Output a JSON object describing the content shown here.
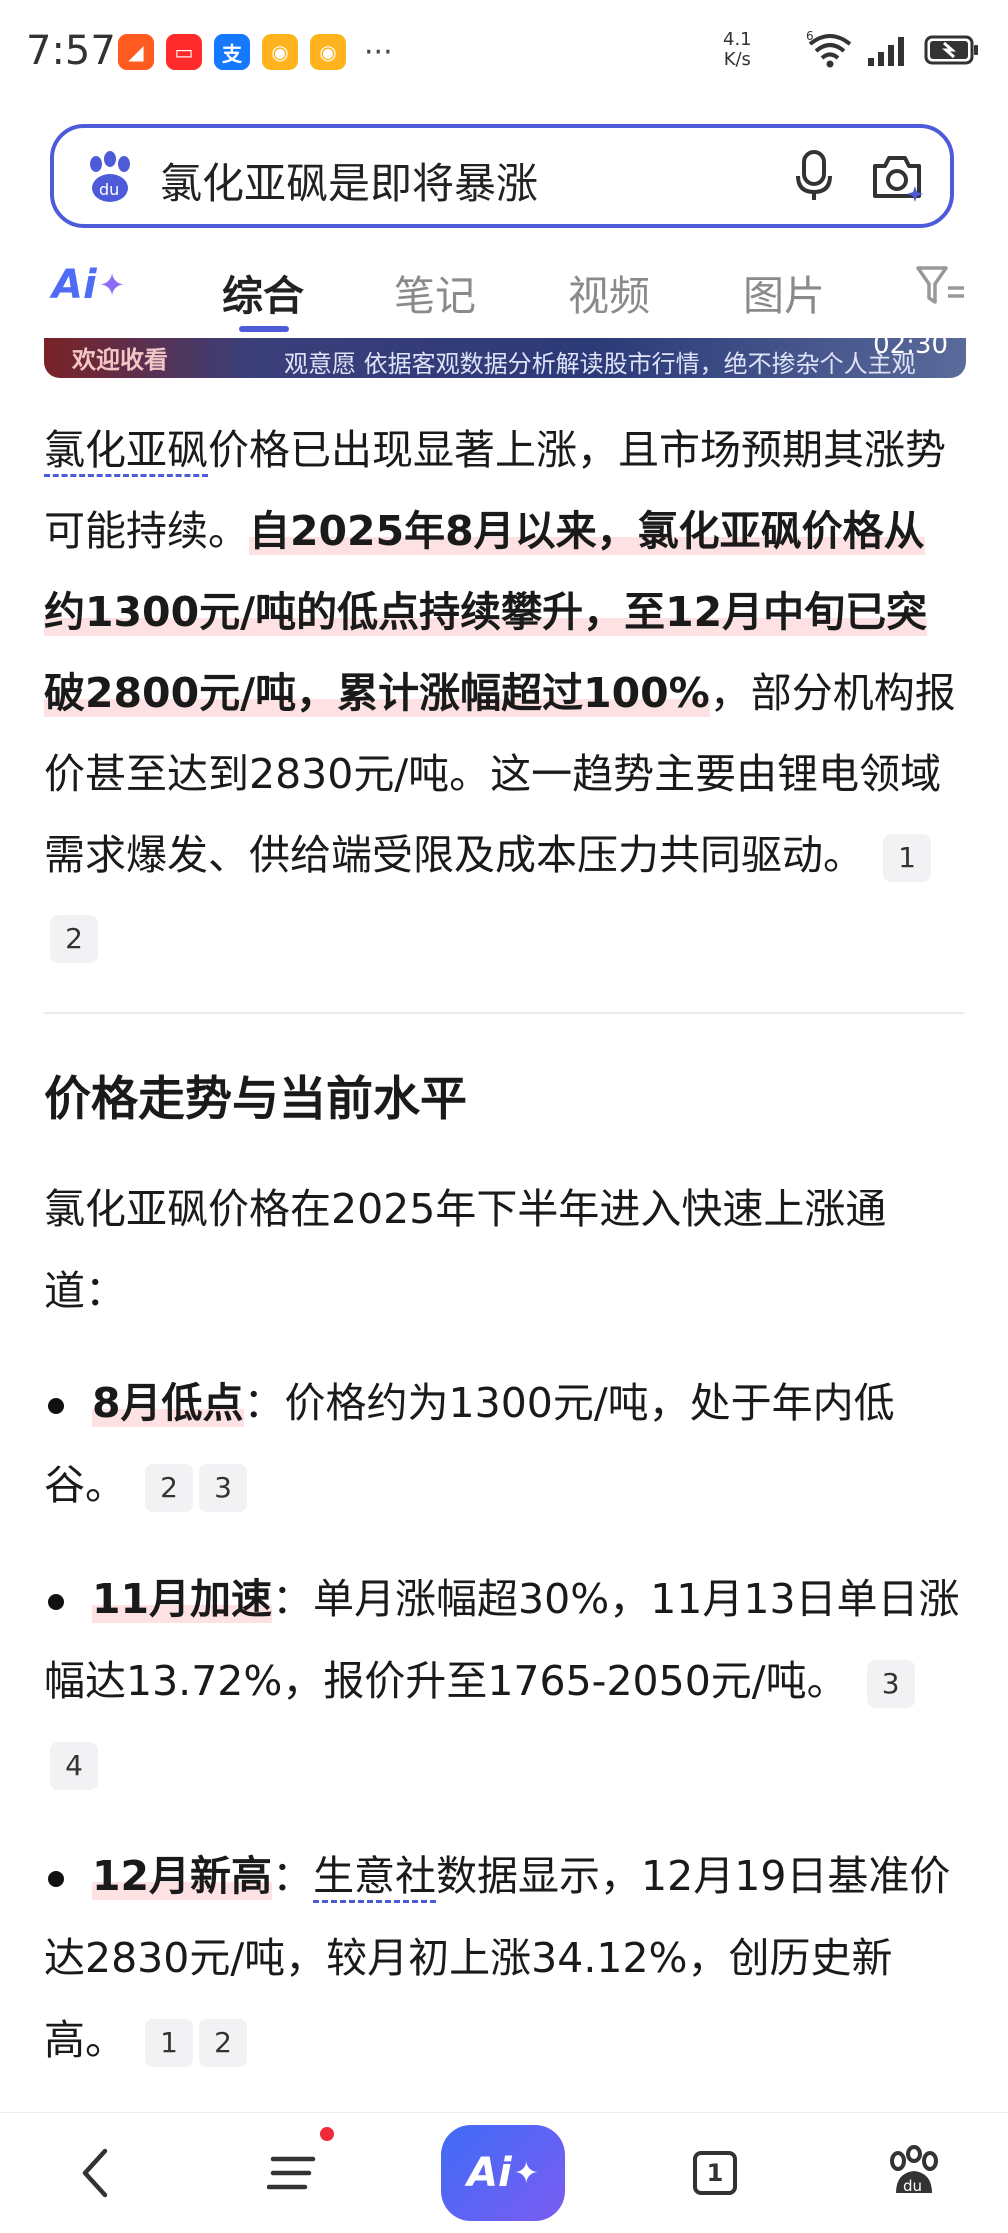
{
  "status_bar": {
    "time": "7:57",
    "overflow": "···",
    "net_speed_value": "4.1",
    "net_speed_unit": "K/s",
    "wifi_label": "6",
    "battery": "full"
  },
  "search": {
    "query": "氯化亚砜是即将暴涨"
  },
  "tabs": {
    "ai_label": "Ai",
    "items": [
      "综合",
      "笔记",
      "视频",
      "图片"
    ],
    "active": "综合"
  },
  "video_strip": {
    "left_text": "欢迎收看",
    "center_text": "观意愿  依据客观数据分析解读股市行情，绝不掺杂个人主观",
    "time": "02:30"
  },
  "intro": {
    "link_term": "氯化亚砜",
    "part1_rest": "价格已出现显著上涨，且市场预期其涨势可能持续。",
    "highlight": "自2025年8月以来，氯化亚砜价格从约1300元/吨的低点持续攀升，至12月中旬已突破2800元/吨，累计涨幅超过100%",
    "part2": "，部分机构报价甚至达到2830元/吨。这一趋势主要由锂电领域需求爆发、供给端受限及成本压力共同驱动。",
    "citations": [
      "1",
      "2"
    ]
  },
  "section": {
    "heading": "价格走势与当前水平",
    "intro": "氯化亚砜价格在2025年下半年进入快速上涨通道：",
    "bullets": [
      {
        "label": "8月低点",
        "text": "：价格约为1300元/吨，处于年内低谷。",
        "citations": [
          "2",
          "3"
        ]
      },
      {
        "label": "11月加速",
        "text": "：单月涨幅超30%，11月13日单日涨幅达13.72%，报价升至1765-2050元/吨。",
        "citations": [
          "3",
          "4"
        ]
      },
      {
        "label": "12月新高",
        "link": "生意社",
        "text": "数据显示，12月19日基准价达2830元/吨，较月初上涨34.12%，创历史新高。",
        "prefix": "：",
        "citations": [
          "1",
          "2"
        ]
      }
    ]
  },
  "bottom_nav": {
    "ai_label": "Ai",
    "tab_count": "1"
  }
}
